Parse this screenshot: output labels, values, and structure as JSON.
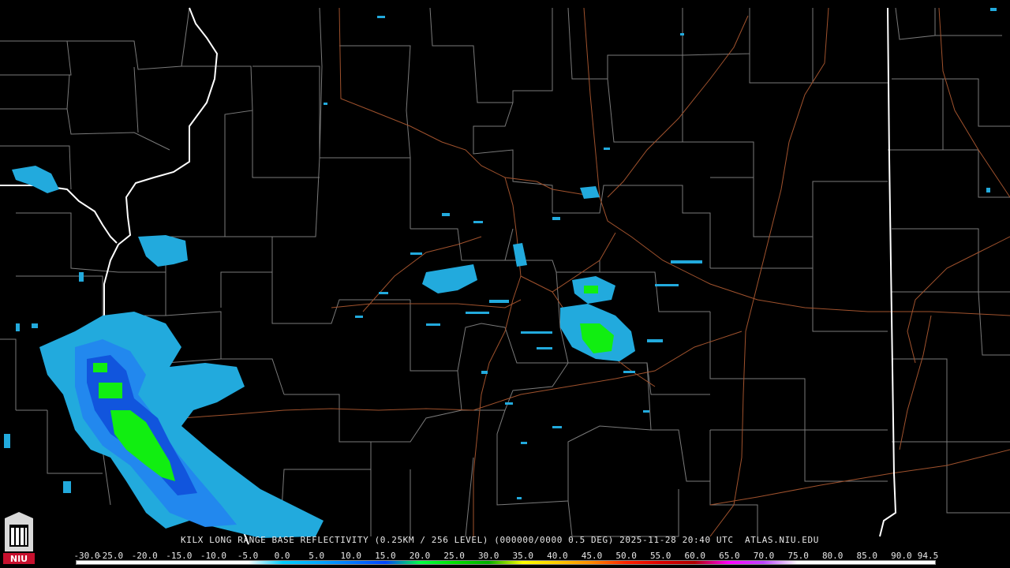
{
  "map": {
    "caption": "KILX LONG RANGE BASE REFLECTIVITY (0.25KM / 256 LEVEL) (000000/0000 0.5 DEG) 2025-11-28 20:40 UTC  ATLAS.NIU.EDU",
    "legend": {
      "values": [
        "-30.0",
        "-25.0",
        "-20.0",
        "-15.0",
        "-10.0",
        "-5.0",
        "0.0",
        "5.0",
        "10.0",
        "15.0",
        "20.0",
        "25.0",
        "30.0",
        "35.0",
        "40.0",
        "45.0",
        "50.0",
        "55.0",
        "60.0",
        "65.0",
        "70.0",
        "75.0",
        "80.0",
        "85.0",
        "90.0",
        "94.5"
      ],
      "colors": [
        "#ffffff",
        "#ffffff",
        "#ffffff",
        "#ffffff",
        "#ffffff",
        "#ffffff",
        "#00ccff",
        "#00a8ff",
        "#0077ff",
        "#0044ff",
        "#00ff44",
        "#00e000",
        "#00b000",
        "#ffff00",
        "#ffcc00",
        "#ff8800",
        "#ff2200",
        "#dd0000",
        "#b00000",
        "#ff00ff",
        "#bb44ff",
        "#ffffff",
        "#ffffff",
        "#ffffff",
        "#ffffff",
        "#ffffff"
      ]
    },
    "logo_text": "NIU",
    "colors": {
      "county_lines": "#7a7a7a",
      "state_lines": "#ffffff",
      "highways": "#a0522d",
      "echo_light": "#22aadd",
      "echo_medium": "#2288ee",
      "echo_dark": "#1155dd",
      "echo_green": "#11ee11"
    }
  }
}
